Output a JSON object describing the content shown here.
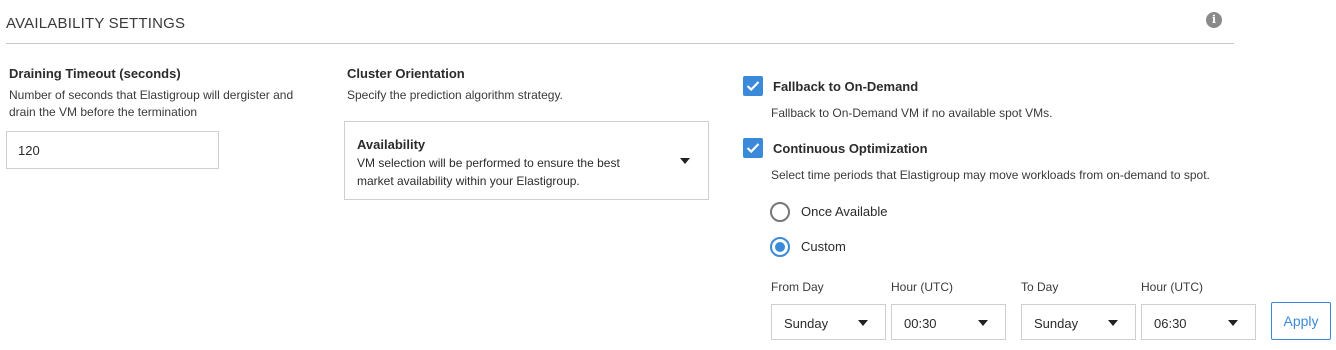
{
  "header": {
    "title": "AVAILABILITY SETTINGS",
    "info_icon": "i"
  },
  "draining": {
    "label": "Draining Timeout (seconds)",
    "description_line1": "Number of seconds that Elastigroup will dergister and",
    "description_line2": "drain the VM before the termination",
    "value": "120"
  },
  "orientation": {
    "label": "Cluster Orientation",
    "description": "Specify the prediction algorithm strategy.",
    "selected_title": "Availability",
    "selected_desc_line1": "VM selection will be performed to ensure the best",
    "selected_desc_line2": "market availability within your Elastigroup."
  },
  "fallback": {
    "label": "Fallback to On-Demand",
    "checked": true,
    "description": "Fallback to On-Demand VM if no available spot VMs."
  },
  "optimization": {
    "label": "Continuous Optimization",
    "checked": true,
    "description": "Select time periods that Elastigroup may move workloads from on-demand to spot.",
    "options": [
      {
        "label": "Once Available",
        "selected": false
      },
      {
        "label": "Custom",
        "selected": true
      }
    ]
  },
  "schedule": {
    "from_day_label": "From Day",
    "from_day": "Sunday",
    "from_hour_label": "Hour (UTC)",
    "from_hour": "00:30",
    "to_day_label": "To Day",
    "to_day": "Sunday",
    "to_hour_label": "Hour (UTC)",
    "to_hour": "06:30",
    "apply_label": "Apply"
  },
  "colors": {
    "accent": "#3b8ad9",
    "border": "#cfcfcf",
    "divider": "#c9c9c9"
  }
}
